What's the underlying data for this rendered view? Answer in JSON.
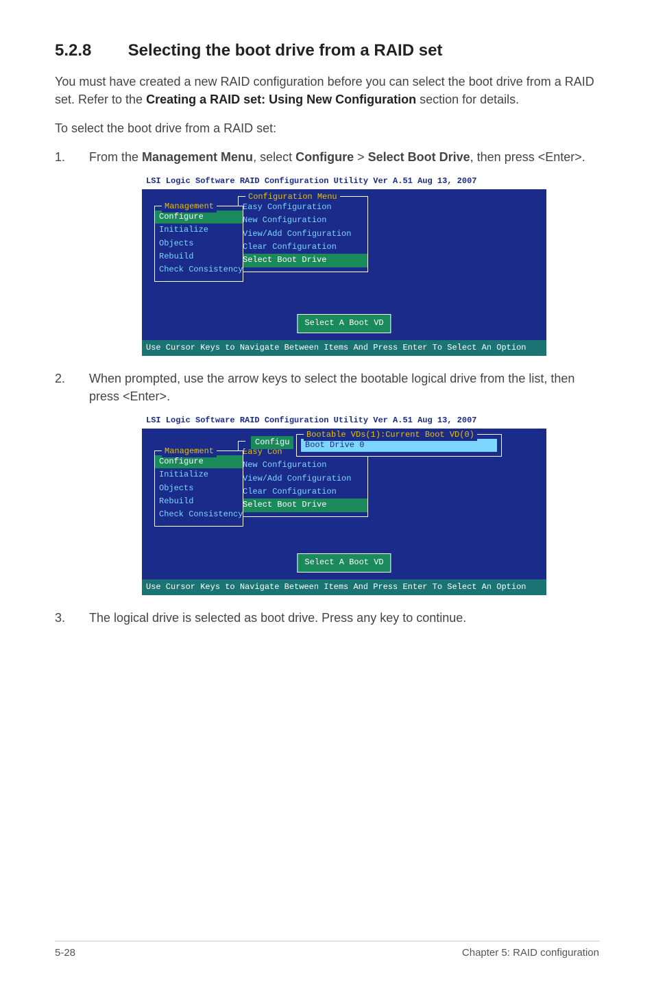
{
  "heading": {
    "number": "5.2.8",
    "title": "Selecting the boot drive from a RAID set"
  },
  "intro1": "You must have created a new RAID configuration before you can select the boot drive from a RAID set. Refer to the ",
  "intro1_bold": "Creating a RAID set: Using New Configuration",
  "intro1_suffix": " section for details.",
  "intro2": "To select the boot drive from a RAID set:",
  "step1_pre": "From the ",
  "step1_b1": "Management Menu",
  "step1_mid1": ", select ",
  "step1_b2": "Configure",
  "step1_gt": " > ",
  "step1_b3": "Select Boot Drive",
  "step1_post": ", then press <Enter>.",
  "step2": "When prompted, use the arrow keys to select the bootable logical drive from the list, then press <Enter>.",
  "step3": "The logical drive is selected as boot drive. Press any key to continue.",
  "bios": {
    "title": "LSI Logic Software RAID Configuration Utility Ver A.51 Aug 13, 2007",
    "mgmt_title": "Management",
    "mgmt_items": {
      "configure": "Configure",
      "initialize": "Initialize",
      "objects": "Objects",
      "rebuild": "Rebuild",
      "check": "Check Consistency"
    },
    "conf_title": "Configuration Menu",
    "conf_items": {
      "easy": "Easy Configuration",
      "new": "New Configuration",
      "viewadd": "View/Add Configuration",
      "clear": "Clear Configuration",
      "select": "Select Boot Drive"
    },
    "conf_trunc1": "Configu",
    "conf_trunc2": "Easy Con",
    "bootvds_title": "Bootable VDs(1):Current Boot VD(0)",
    "bootvds_item": "Boot Drive 0",
    "prompt": "Select A Boot VD",
    "footer": "Use Cursor Keys to Navigate Between Items And Press Enter To Select An Option"
  },
  "footer": {
    "left": "5-28",
    "right": "Chapter 5: RAID configuration"
  }
}
